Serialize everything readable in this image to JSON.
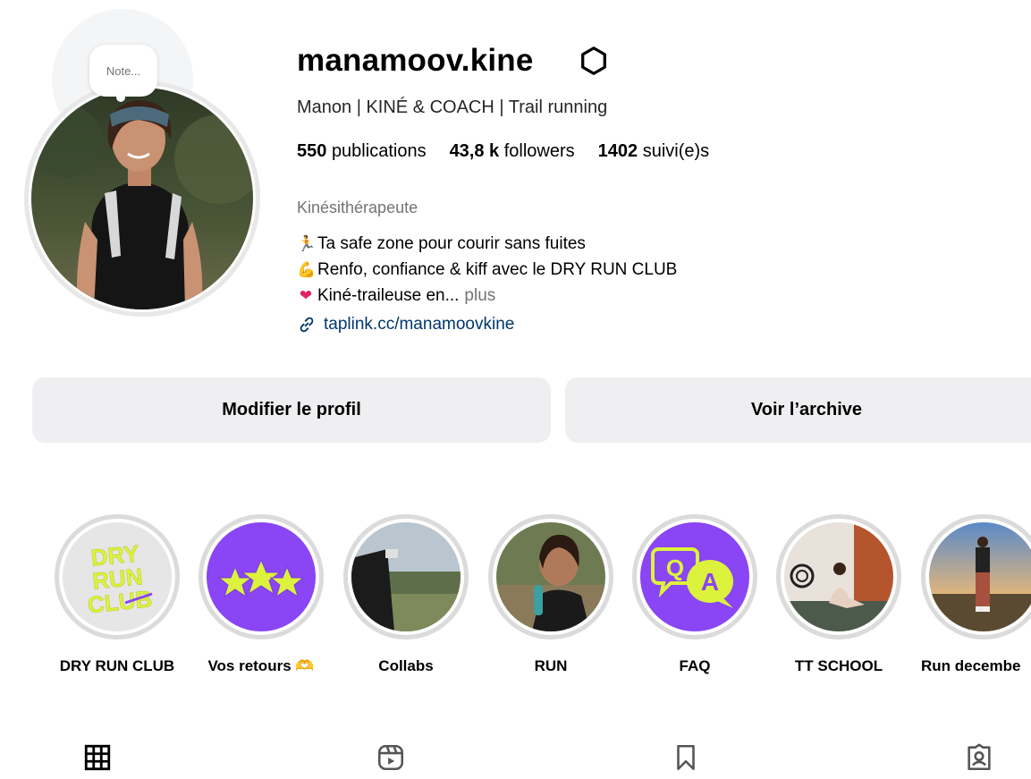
{
  "profile": {
    "note_placeholder": "Note...",
    "username": "manamoov.kine",
    "full_name": "Manon | KINÉ & COACH | Trail running",
    "stats": {
      "posts": "550",
      "posts_label": "publications",
      "followers": "43,8 k",
      "followers_label": "followers",
      "following": "1402",
      "following_label": "suivi(e)s"
    },
    "category": "Kinésithérapeute",
    "bio": {
      "line1_emoji": "🏃",
      "line1": "Ta safe zone pour courir sans fuites",
      "line2_emoji": "💪",
      "line2": "Renfo, confiance & kiff avec le DRY RUN CLUB",
      "line3_emoji": "❤",
      "line3": "Kiné-traileuse en...",
      "more": "plus"
    },
    "link": "taplink.cc/manamoovkine"
  },
  "actions": {
    "edit_profile": "Modifier le profil",
    "view_archive": "Voir l’archive"
  },
  "highlights": [
    {
      "label": "DRY RUN CLUB",
      "cover_text": "DRY RUN CLUB"
    },
    {
      "label": "Vos retours 🫶"
    },
    {
      "label": "Collabs"
    },
    {
      "label": "RUN"
    },
    {
      "label": "FAQ",
      "cover_text_q": "Q",
      "cover_text_a": "A"
    },
    {
      "label": "TT SCHOOL"
    },
    {
      "label": "Run decembe"
    }
  ],
  "tabs": [
    {
      "icon": "grid-icon"
    },
    {
      "icon": "reels-icon"
    },
    {
      "icon": "bookmark-icon"
    },
    {
      "icon": "tagged-icon"
    }
  ],
  "colors": {
    "purple": "#8a45f5",
    "lime": "#dcf23c",
    "button_bg": "#efeff2",
    "link": "#00376b",
    "muted": "#737373"
  }
}
